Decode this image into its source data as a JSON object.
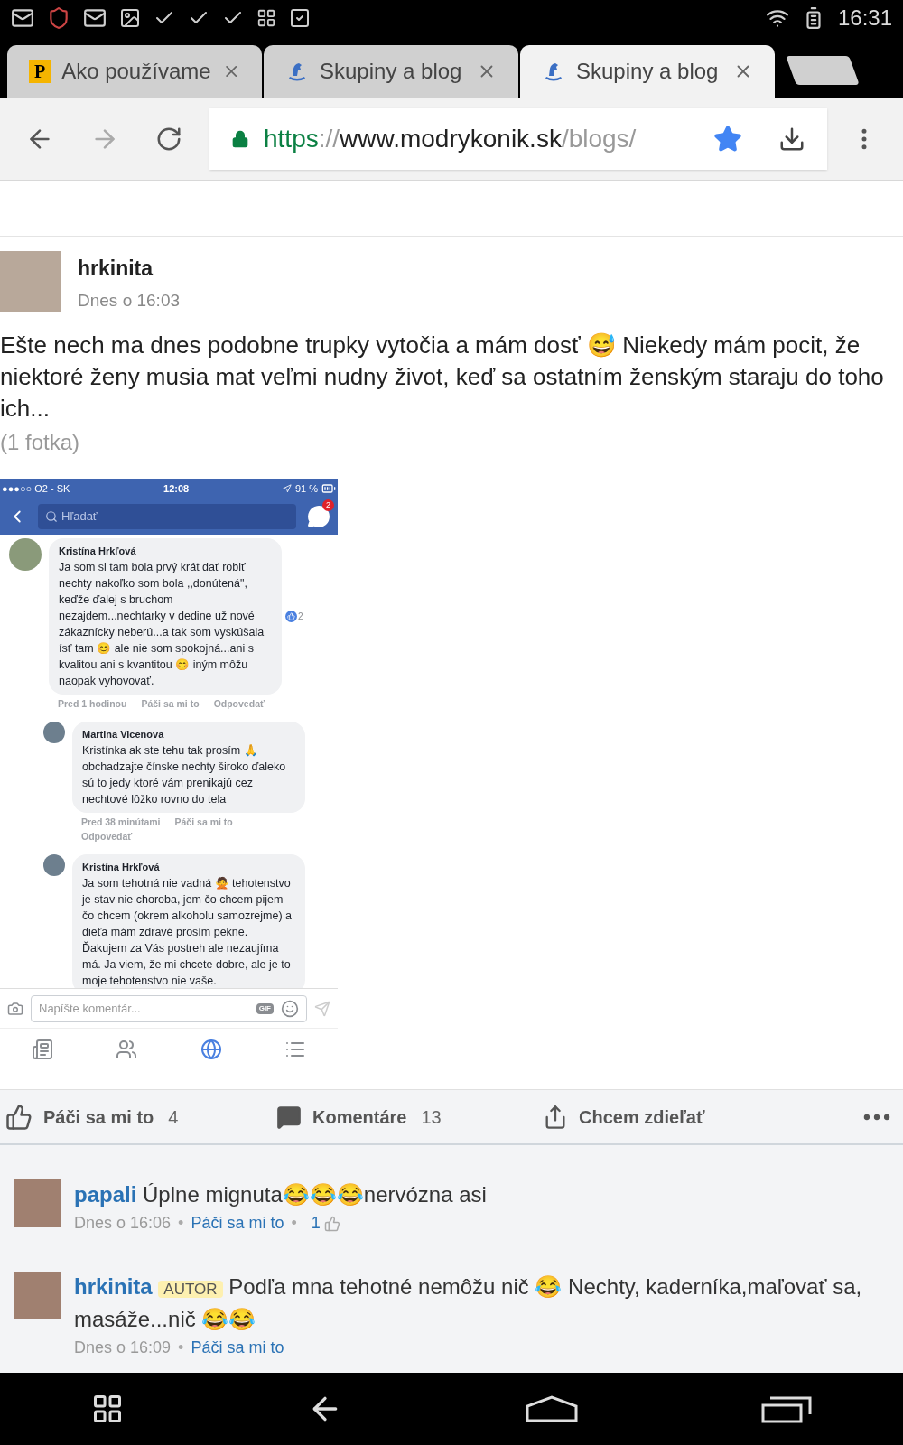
{
  "status_bar": {
    "time": "16:31"
  },
  "tabs": [
    {
      "favicon": {
        "kind": "letter",
        "text": "P"
      },
      "title": "Ako používame",
      "selected": false
    },
    {
      "favicon": {
        "kind": "horse"
      },
      "title": "Skupiny a blog",
      "selected": false
    },
    {
      "favicon": {
        "kind": "horse"
      },
      "title": "Skupiny a blog",
      "selected": true
    }
  ],
  "toolbar": {
    "url": {
      "scheme": "https",
      "separator": "://",
      "host": "www.modrykonik.sk",
      "path": "/blogs/"
    },
    "secure": true,
    "bookmarked": true
  },
  "post": {
    "author": "hrkinita",
    "time": "Dnes o 16:03",
    "text": "Ešte nech ma dnes podobne trupky vytočia a mám dosť 😅 Niekedy mám pocit, že niektoré ženy musia mat veľmi nudny život, keď sa ostatním ženským staraju do toho ich...",
    "photo_count": "(1 fotka)",
    "screenshot": {
      "status": {
        "carrier": "●●●○○ O2 - SK",
        "time": "12:08",
        "battery": "91 %"
      },
      "search_placeholder": "Hľadať",
      "messenger_badge": "2",
      "comments": [
        {
          "author": "Kristína Hrkľová",
          "text": "Ja som si tam bola prvý krát dať robiť nechty nakoľko som bola ,,donútená\", keďže ďalej s bruchom nezajdem...nechtarky v dedine už nové zákaznícky neberú...a tak som vyskúšala ísť tam 😊 ale nie som spokojná...ani s kvalitou ani s kvantitou 😊 iným môžu naopak vyhovovať.",
          "reaction_count": "2",
          "meta": [
            "Pred 1 hodinou",
            "Páči sa mi to",
            "Odpovedať"
          ],
          "children": [
            {
              "author": "Martina Vicenova",
              "text": "Kristínka ak ste tehu tak prosím 🙏 obchadzajte čínske nechty široko ďaleko sú to jedy ktoré vám prenikajú cez nechtové lôžko rovno do tela",
              "meta": [
                "Pred 38 minútami",
                "Páči sa mi to",
                "Odpovedať"
              ]
            },
            {
              "author": "Kristína Hrkľová",
              "text": "Ja som tehotná nie vadná 🙅 tehotenstvo je stav nie choroba, jem čo chcem pijem čo chcem (okrem alkoholu samozrejme) a dieťa mám zdravé prosím pekne. Ďakujem za Vás postreh ale nezaujíma má. Ja viem, že mi chcete dobre, ale je to moje tehotenstvo nie vaše."
            }
          ]
        }
      ],
      "composer_placeholder": "Napíšte komentár...",
      "gif_label": "GIF",
      "nav": [
        {
          "kind": "feed",
          "selected": false
        },
        {
          "kind": "friends",
          "selected": false
        },
        {
          "kind": "globe",
          "selected": true
        },
        {
          "kind": "menu",
          "selected": false
        }
      ]
    }
  },
  "actions": [
    {
      "kind": "like",
      "label": "Páči sa mi to",
      "count": "4"
    },
    {
      "kind": "comment",
      "label": "Komentáre",
      "count": "13"
    },
    {
      "kind": "share",
      "label": "Chcem zdieľať"
    }
  ],
  "comments": [
    {
      "author": "papali",
      "text": "Úplne mignuta😂😂😂nervózna asi",
      "meta": [
        {
          "kind": "time",
          "text": "Dnes o 16:06"
        },
        {
          "kind": "separator",
          "text": "•"
        },
        {
          "kind": "like",
          "text": "Páči sa mi to"
        },
        {
          "kind": "separator",
          "text": "•"
        },
        {
          "kind": "likes",
          "text": "1"
        }
      ]
    },
    {
      "author": "hrkinita",
      "badge": "AUTOR",
      "text": "Podľa mna tehotné nemôžu nič 😂 Nechty, kaderníka,maľovať sa, masáže...nič 😂😂",
      "meta": [
        {
          "kind": "time",
          "text": "Dnes o 16:09"
        },
        {
          "kind": "separator",
          "text": "•"
        },
        {
          "kind": "like",
          "text": "Páči sa mi to"
        }
      ]
    }
  ]
}
